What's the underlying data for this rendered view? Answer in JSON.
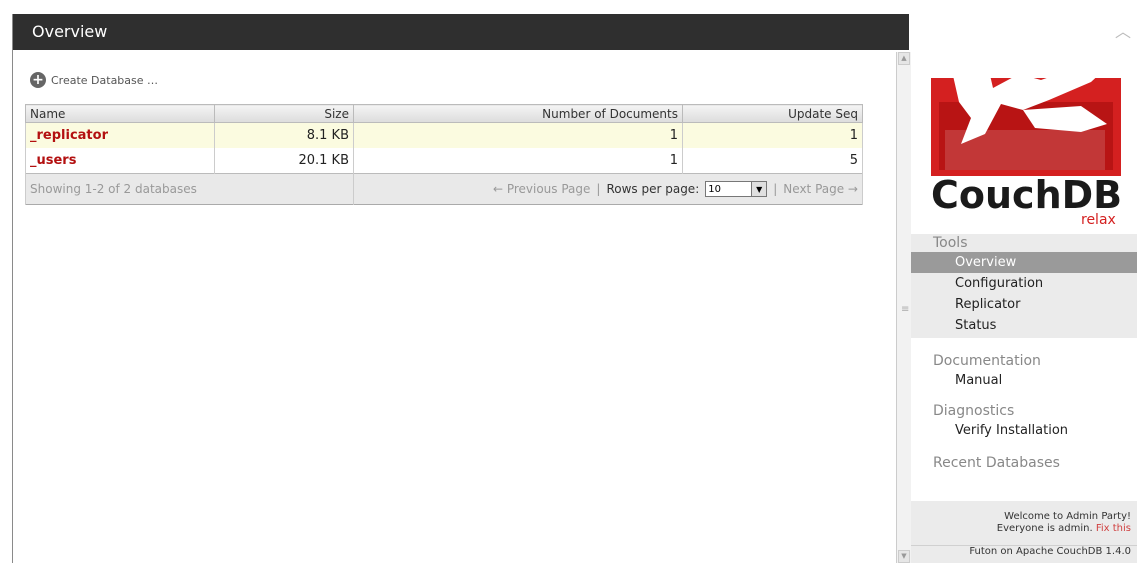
{
  "header": {
    "title": "Overview"
  },
  "toolbar": {
    "create_label": "Create Database …"
  },
  "table": {
    "columns": [
      "Name",
      "Size",
      "Number of Documents",
      "Update Seq"
    ],
    "rows": [
      {
        "name": "_replicator",
        "size": "8.1 KB",
        "docs": "1",
        "seq": "1"
      },
      {
        "name": "_users",
        "size": "20.1 KB",
        "docs": "1",
        "seq": "5"
      }
    ],
    "footer": {
      "showing": "Showing 1-2 of 2 databases",
      "prev": "← Previous Page",
      "sep": "|",
      "rpp_label": "Rows per page:",
      "rpp_value": "10",
      "next": "Next Page →"
    }
  },
  "sidebar": {
    "logo_text": "CouchDB",
    "logo_tagline": "relax",
    "tools_title": "Tools",
    "tools_items": [
      "Overview",
      "Configuration",
      "Replicator",
      "Status"
    ],
    "doc_title": "Documentation",
    "doc_items": [
      "Manual"
    ],
    "diag_title": "Diagnostics",
    "diag_items": [
      "Verify Installation"
    ],
    "recent_title": "Recent Databases",
    "welcome_line1": "Welcome to Admin Party!",
    "welcome_line2": "Everyone is admin.",
    "fix_link": "Fix this",
    "version": "Futon on Apache CouchDB 1.4.0"
  },
  "colors": {
    "accent": "#b31010",
    "header_bg": "#2f2f2f",
    "logo_red": "#d42020"
  }
}
